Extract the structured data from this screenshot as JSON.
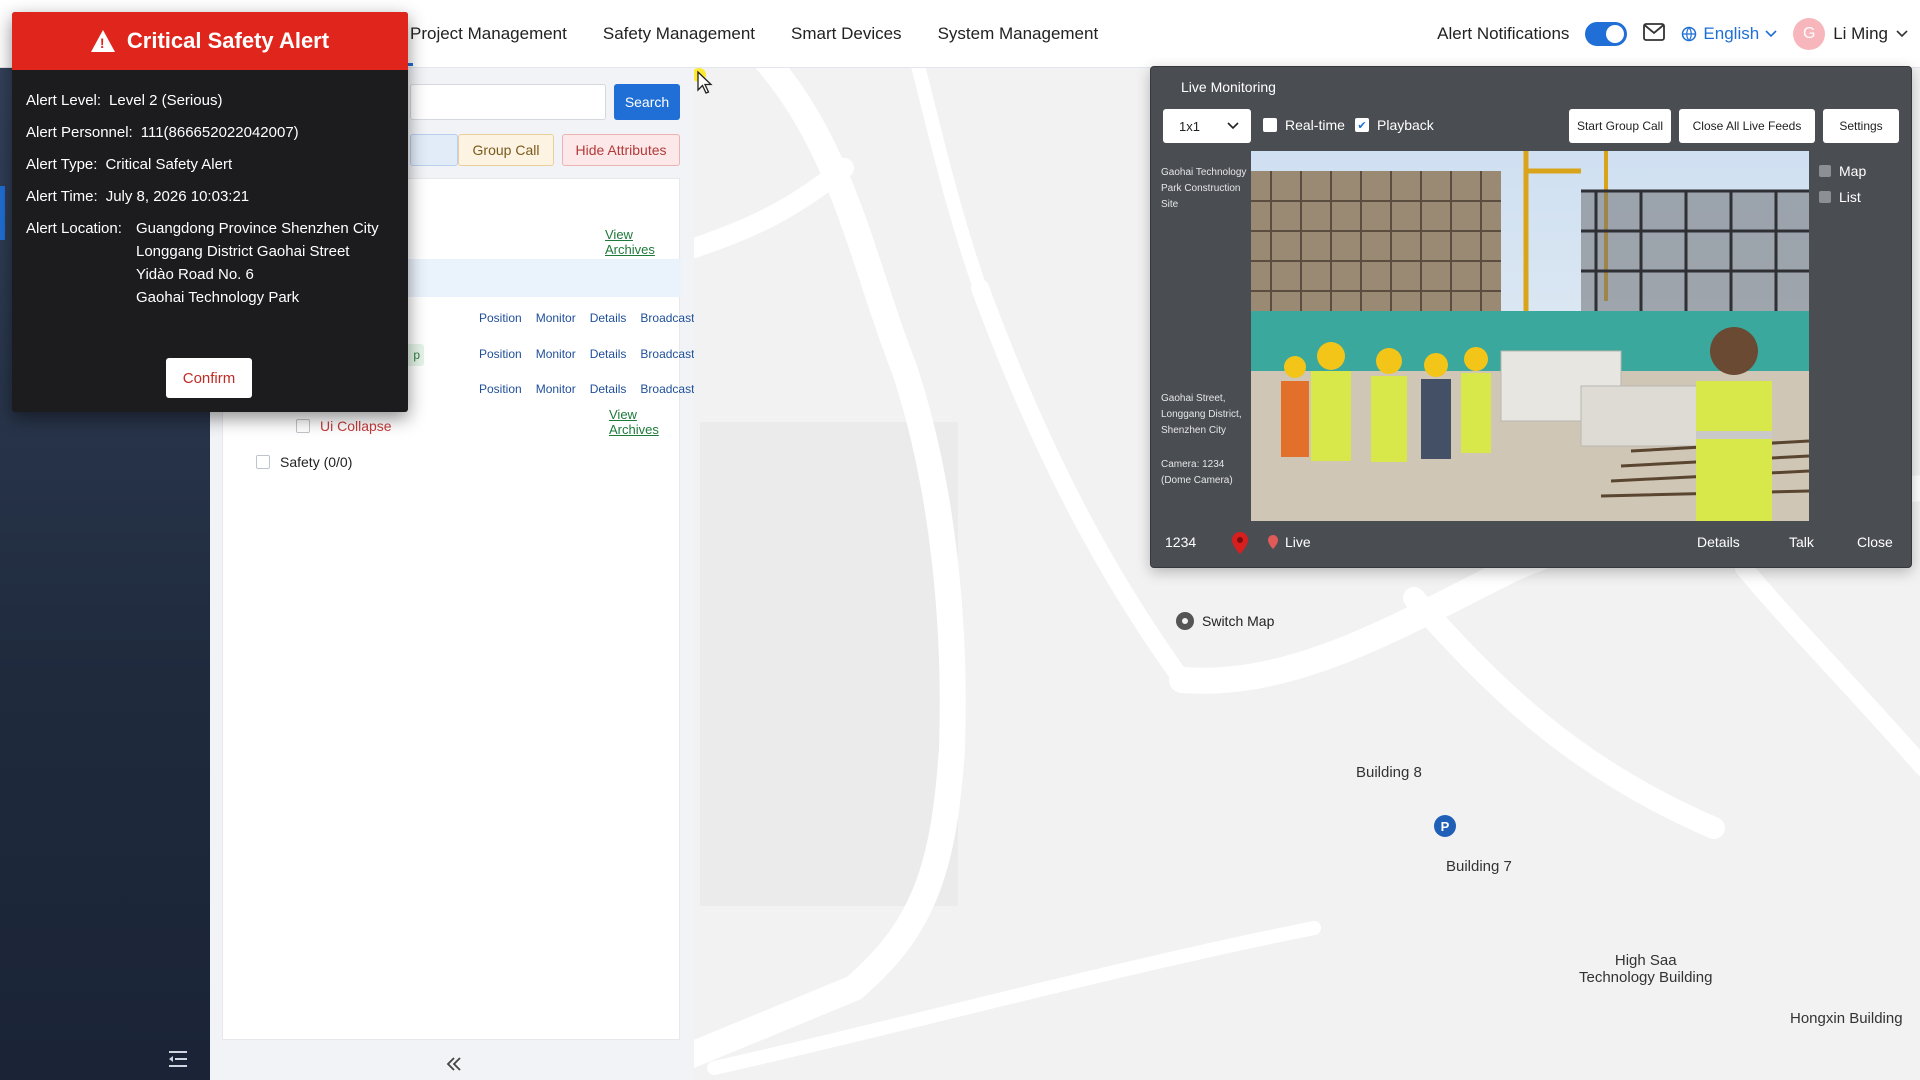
{
  "nav": {
    "active_glyph": "s",
    "items": [
      "Project Management",
      "Safety Management",
      "Smart Devices",
      "System Management"
    ]
  },
  "header": {
    "alert_notifications_label": "Alert Notifications",
    "alert_notifications_on": true,
    "mail_icon": "mail-icon",
    "language": "English",
    "user_initial": "G",
    "user_name": "Li Ming"
  },
  "alert": {
    "title": "Critical Safety Alert",
    "level_label": "Alert Level:",
    "level": "Level 2 (Serious)",
    "personnel_label": "Alert Personnel:",
    "personnel": "111(866652022042007)",
    "type_label": "Alert Type:",
    "type": "Critical Safety Alert",
    "time_label": "Alert Time:",
    "time": "July 8, 2026 10:03:21",
    "location_label": "Alert Location:",
    "location_lines": [
      "Guangdong Province Shenzhen City",
      "Longgang District Gaohai Street",
      "Yidào Road No. 6",
      "Gaohai Technology Park"
    ],
    "confirm": "Confirm"
  },
  "panel": {
    "search_button": "Search",
    "group_call": "Group Call",
    "hide_attributes": "Hide Attributes",
    "view_archives": "View Archives",
    "row_actions": [
      "Position",
      "Monitor",
      "Details",
      "Broadcast"
    ],
    "green_tag_text": "p",
    "ui_collapse": "Ui Collapse",
    "safety": "Safety (0/0)"
  },
  "live": {
    "title": "Live Monitoring",
    "layout_value": "1x1",
    "realtime_label": "Real-time",
    "realtime_checked": false,
    "playback_label": "Playback",
    "playback_checked": true,
    "start_group_call": "Start Group Call",
    "close_all": "Close All Live Feeds",
    "settings": "Settings",
    "site_name": "Gaohai Technology Park Construction Site",
    "location_text": "Gaohai Street, Longgang District, Shenzhen City",
    "camera_text": "Camera: 1234 (Dome Camera)",
    "map_option": "Map",
    "list_option": "List",
    "camera_id": "1234",
    "live_label": "Live",
    "details": "Details",
    "talk": "Talk",
    "close": "Close"
  },
  "map": {
    "switch_map": "Switch Map",
    "labels": {
      "building8": "Building 8",
      "building7": "Building 7",
      "high_saa_line1": "High Saa",
      "high_saa_line2": "Technology Building",
      "hongxin": "Hongxin Building"
    },
    "parking_label": "P"
  }
}
